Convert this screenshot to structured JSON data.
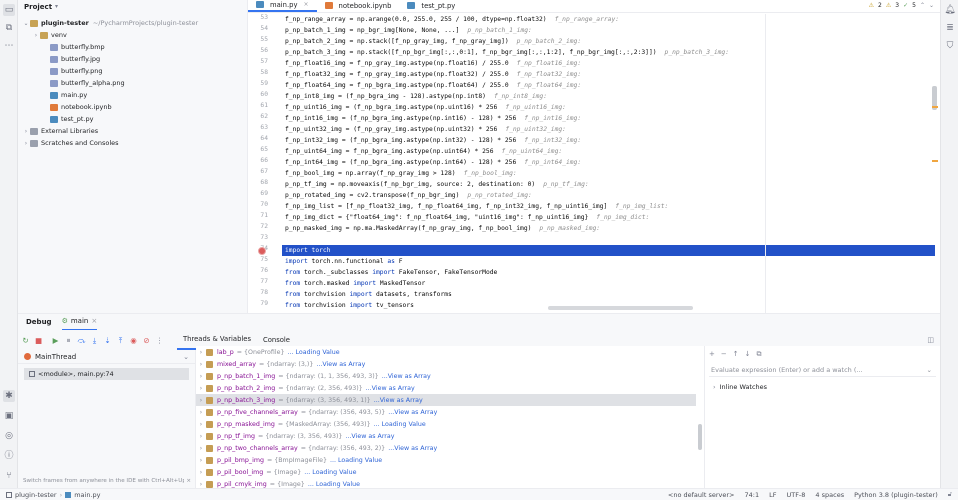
{
  "project_panel": {
    "title": "Project",
    "tree": [
      {
        "label": "plugin-tester",
        "extra": "~/PycharmProjects/plugin-tester",
        "icon": "folder",
        "arrow": "⌄",
        "indent": 0
      },
      {
        "label": "venv",
        "extra": "",
        "icon": "folder",
        "arrow": "›",
        "indent": 1
      },
      {
        "label": "butterfly.bmp",
        "extra": "",
        "icon": "img",
        "arrow": "",
        "indent": 2
      },
      {
        "label": "butterfly.jpg",
        "extra": "",
        "icon": "img",
        "arrow": "",
        "indent": 2
      },
      {
        "label": "butterfly.png",
        "extra": "",
        "icon": "img",
        "arrow": "",
        "indent": 2
      },
      {
        "label": "butterfly_alpha.png",
        "extra": "",
        "icon": "img",
        "arrow": "",
        "indent": 2
      },
      {
        "label": "main.py",
        "extra": "",
        "icon": "py",
        "arrow": "",
        "indent": 2
      },
      {
        "label": "notebook.ipynb",
        "extra": "",
        "icon": "nb",
        "arrow": "",
        "indent": 2
      },
      {
        "label": "test_pt.py",
        "extra": "",
        "icon": "py",
        "arrow": "",
        "indent": 2
      },
      {
        "label": "External Libraries",
        "extra": "",
        "icon": "lib",
        "arrow": "›",
        "indent": 0
      },
      {
        "label": "Scratches and Consoles",
        "extra": "",
        "icon": "lib",
        "arrow": "›",
        "indent": 0
      }
    ]
  },
  "editor": {
    "tabs": [
      {
        "label": "main.py",
        "active": true,
        "closable": true
      },
      {
        "label": "notebook.ipynb",
        "active": false,
        "closable": false
      },
      {
        "label": "test_pt.py",
        "active": false,
        "closable": false
      }
    ],
    "inspection": {
      "warnings": "2",
      "weak": "3",
      "ok": "5"
    },
    "lines": [
      {
        "n": "53",
        "code": "f_np_range_array = np.arange(0.0, 255.0, 255 / 100, dtype=np.float32)",
        "hint": "f_np_range_array:"
      },
      {
        "n": "54",
        "code": "p_np_batch_1_img = np_bgr_img[None, None, ...]",
        "hint": "p_np_batch_1_img:"
      },
      {
        "n": "55",
        "code": "p_np_batch_2_img = np.stack([f_np_gray_img, f_np_gray_img])",
        "hint": "p_np_batch_2_img:"
      },
      {
        "n": "56",
        "code": "p_np_batch_3_img = np.stack([f_np_bgr_img[:,:,0:1], f_np_bgr_img[:,:,1:2], f_np_bgr_img[:,:,2:3]])",
        "hint": "p_np_batch_3_img:"
      },
      {
        "n": "57",
        "code": "f_np_float16_img = f_np_gray_img.astype(np.float16) / 255.0",
        "hint": "f_np_float16_img:"
      },
      {
        "n": "58",
        "code": "f_np_float32_img = f_np_gray_img.astype(np.float32) / 255.0",
        "hint": "f_np_float32_img:"
      },
      {
        "n": "59",
        "code": "f_np_float64_img = f_np_bgra_img.astype(np.float64) / 255.0",
        "hint": "f_np_float64_img:"
      },
      {
        "n": "60",
        "code": "f_np_int8_img = (f_np_bgra_img - 128).astype(np.int8)",
        "hint": "f_np_int8_img:"
      },
      {
        "n": "61",
        "code": "f_np_uint16_img = (f_np_bgra_img.astype(np.uint16) * 256",
        "hint": "f_np_uint16_img:"
      },
      {
        "n": "62",
        "code": "f_np_int16_img = (f_np_bgra_img.astype(np.int16) - 128) * 256",
        "hint": "f_np_int16_img:"
      },
      {
        "n": "63",
        "code": "f_np_uint32_img = (f_np_gray_img.astype(np.uint32) * 256",
        "hint": "f_np_uint32_img:"
      },
      {
        "n": "64",
        "code": "f_np_int32_img = (f_np_bgra_img.astype(np.int32) - 128) * 256",
        "hint": "f_np_int32_img:"
      },
      {
        "n": "65",
        "code": "f_np_uint64_img = f_np_bgra_img.astype(np.uint64) * 256",
        "hint": "f_np_uint64_img:"
      },
      {
        "n": "66",
        "code": "f_np_int64_img = (f_np_bgra_img.astype(np.int64) - 128) * 256",
        "hint": "f_np_int64_img:"
      },
      {
        "n": "67",
        "code": "f_np_bool_img = np.array(f_np_gray_img > 128)",
        "hint": "f_np_bool_img:"
      },
      {
        "n": "68",
        "code": "p_np_tf_img = np.moveaxis(f_np_bgr_img, source: 2, destination: 0)",
        "hint": "p_np_tf_img:"
      },
      {
        "n": "69",
        "code": "p_np_rotated_img = cv2.transpose(f_np_bgr_img)",
        "hint": "p_np_rotated_img:"
      },
      {
        "n": "70",
        "code": "f_np_img_list = [f_np_float32_img, f_np_float64_img, f_np_int32_img, f_np_uint16_img]",
        "hint": "f_np_img_list:"
      },
      {
        "n": "71",
        "code": "f_np_img_dict = {\"float64_img\": f_np_float64_img, \"uint16_img\": f_np_uint16_img}",
        "hint": "f_np_img_dict:"
      },
      {
        "n": "72",
        "code": "p_np_masked_img = np.ma.MaskedArray(f_np_gray_img, f_np_bool_img)",
        "hint": "p_np_masked_img:"
      },
      {
        "n": "73",
        "code": "",
        "hint": ""
      },
      {
        "n": "74",
        "code": "import torch",
        "hint": ""
      },
      {
        "n": "75",
        "code": "import torch.nn.functional as F",
        "hint": ""
      },
      {
        "n": "76",
        "code": "from torch._subclasses import FakeTensor, FakeTensorMode",
        "hint": ""
      },
      {
        "n": "77",
        "code": "from torch.masked import MaskedTensor",
        "hint": ""
      },
      {
        "n": "78",
        "code": "from torchvision import datasets, transforms",
        "hint": ""
      },
      {
        "n": "79",
        "code": "from torchvision import tv_tensors",
        "hint": ""
      }
    ]
  },
  "debug": {
    "title": "Debug",
    "session": "main",
    "subtabs": [
      "Threads & Variables",
      "Console"
    ],
    "thread": "MainThread",
    "frame": "<module>, main.py:74",
    "hint": "Switch frames from anywhere in the IDE with Ctrl+Alt+Up a...",
    "variables": [
      {
        "name": "lab_p",
        "type": "= {OneProfile}",
        "link": "... Loading Value"
      },
      {
        "name": "mixed_array",
        "type": "= {ndarray: (3,)}",
        "link": "...View as Array"
      },
      {
        "name": "p_np_batch_1_img",
        "type": "= {ndarray: (1, 1, 356, 493, 3)}",
        "link": "...View as Array"
      },
      {
        "name": "p_np_batch_2_img",
        "type": "= {ndarray: (2, 356, 493)}",
        "link": "...View as Array"
      },
      {
        "name": "p_np_batch_3_img",
        "type": "= {ndarray: (3, 356, 493, 1)}",
        "link": "...View as Array"
      },
      {
        "name": "p_np_five_channels_array",
        "type": "= {ndarray: (356, 493, 5)}",
        "link": "...View as Array"
      },
      {
        "name": "p_np_masked_img",
        "type": "= {MaskedArray: (356, 493)}",
        "link": "... Loading Value"
      },
      {
        "name": "p_np_tf_img",
        "type": "= {ndarray: (3, 356, 493)}",
        "link": "...View as Array"
      },
      {
        "name": "p_np_two_channels_array",
        "type": "= {ndarray: (356, 493, 2)}",
        "link": "...View as Array"
      },
      {
        "name": "p_pil_bmp_img",
        "type": "= {BmpImageFile}",
        "link": "... Loading Value"
      },
      {
        "name": "p_pil_bool_img",
        "type": "= {Image}",
        "link": "... Loading Value"
      },
      {
        "name": "p_pil_cmyk_img",
        "type": "= {Image}",
        "link": "... Loading Value"
      }
    ],
    "watch_placeholder": "Evaluate expression (Enter) or add a watch (...",
    "inline_watches": "Inline Watches"
  },
  "statusbar": {
    "breadcrumb_project": "plugin-tester",
    "breadcrumb_file": "main.py",
    "server": "<no default server>",
    "position": "74:1",
    "line_sep": "LF",
    "encoding": "UTF-8",
    "indent": "4 spaces",
    "interpreter": "Python 3.8 (plugin-tester)"
  },
  "colors": {
    "accent": "#3574f0",
    "selection": "#2251c8",
    "breakpoint": "#db5c5c"
  }
}
